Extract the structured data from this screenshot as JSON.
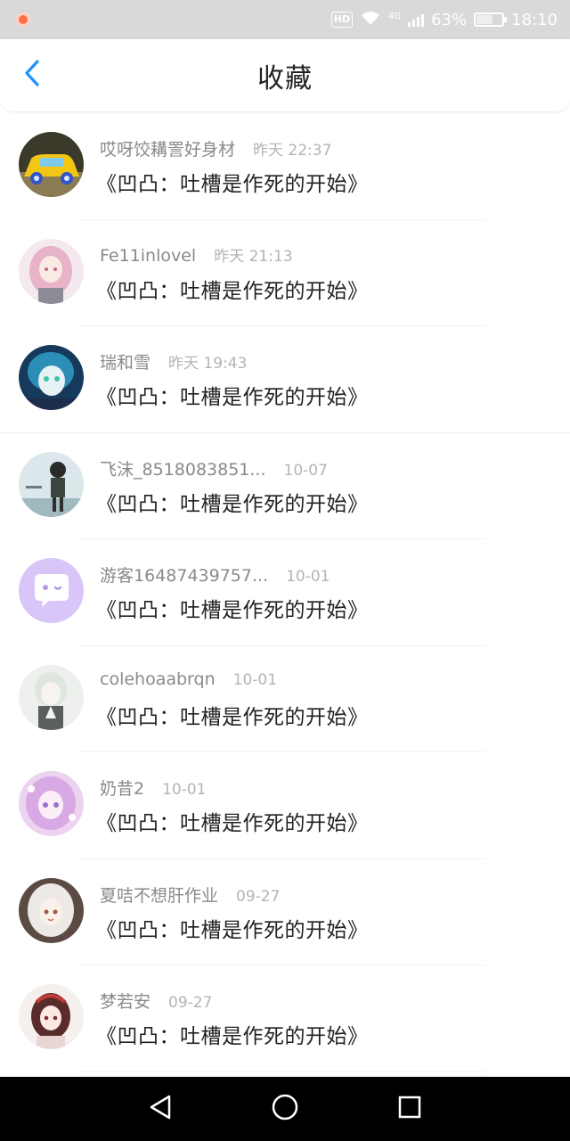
{
  "status_bar": {
    "network": "4G",
    "battery": "63%",
    "battery_level": 0.63,
    "time": "18:10",
    "hd_badge": "HD"
  },
  "header": {
    "title": "收藏",
    "back_icon": "chevron-left-icon",
    "accent_color": "#1e90ff"
  },
  "items": [
    {
      "user": "哎呀饺耩詈好身材",
      "time": "昨天 22:37",
      "text": "《凹凸：吐槽是作死的开始》"
    },
    {
      "user": "Fe11inlovel",
      "time": "昨天 21:13",
      "text": "《凹凸：吐槽是作死的开始》"
    },
    {
      "user": "瑞和雪",
      "time": "昨天 19:43",
      "text": "《凹凸：吐槽是作死的开始》"
    },
    {
      "user": "飞沫_8518083851...",
      "time": "10-07",
      "text": "《凹凸：吐槽是作死的开始》"
    },
    {
      "user": "游客16487439757...",
      "time": "10-01",
      "text": "《凹凸：吐槽是作死的开始》"
    },
    {
      "user": "colehoaabrqn",
      "time": "10-01",
      "text": "《凹凸：吐槽是作死的开始》"
    },
    {
      "user": "奶昔2",
      "time": "10-01",
      "text": "《凹凸：吐槽是作死的开始》"
    },
    {
      "user": "夏咭不想肝作业",
      "time": "09-27",
      "text": "《凹凸：吐槽是作死的开始》"
    },
    {
      "user": "梦若安",
      "time": "09-27",
      "text": "《凹凸：吐槽是作死的开始》"
    }
  ],
  "nav_bar": {
    "back_icon": "triangle-back-icon",
    "home_icon": "circle-home-icon",
    "recents_icon": "square-recents-icon"
  }
}
